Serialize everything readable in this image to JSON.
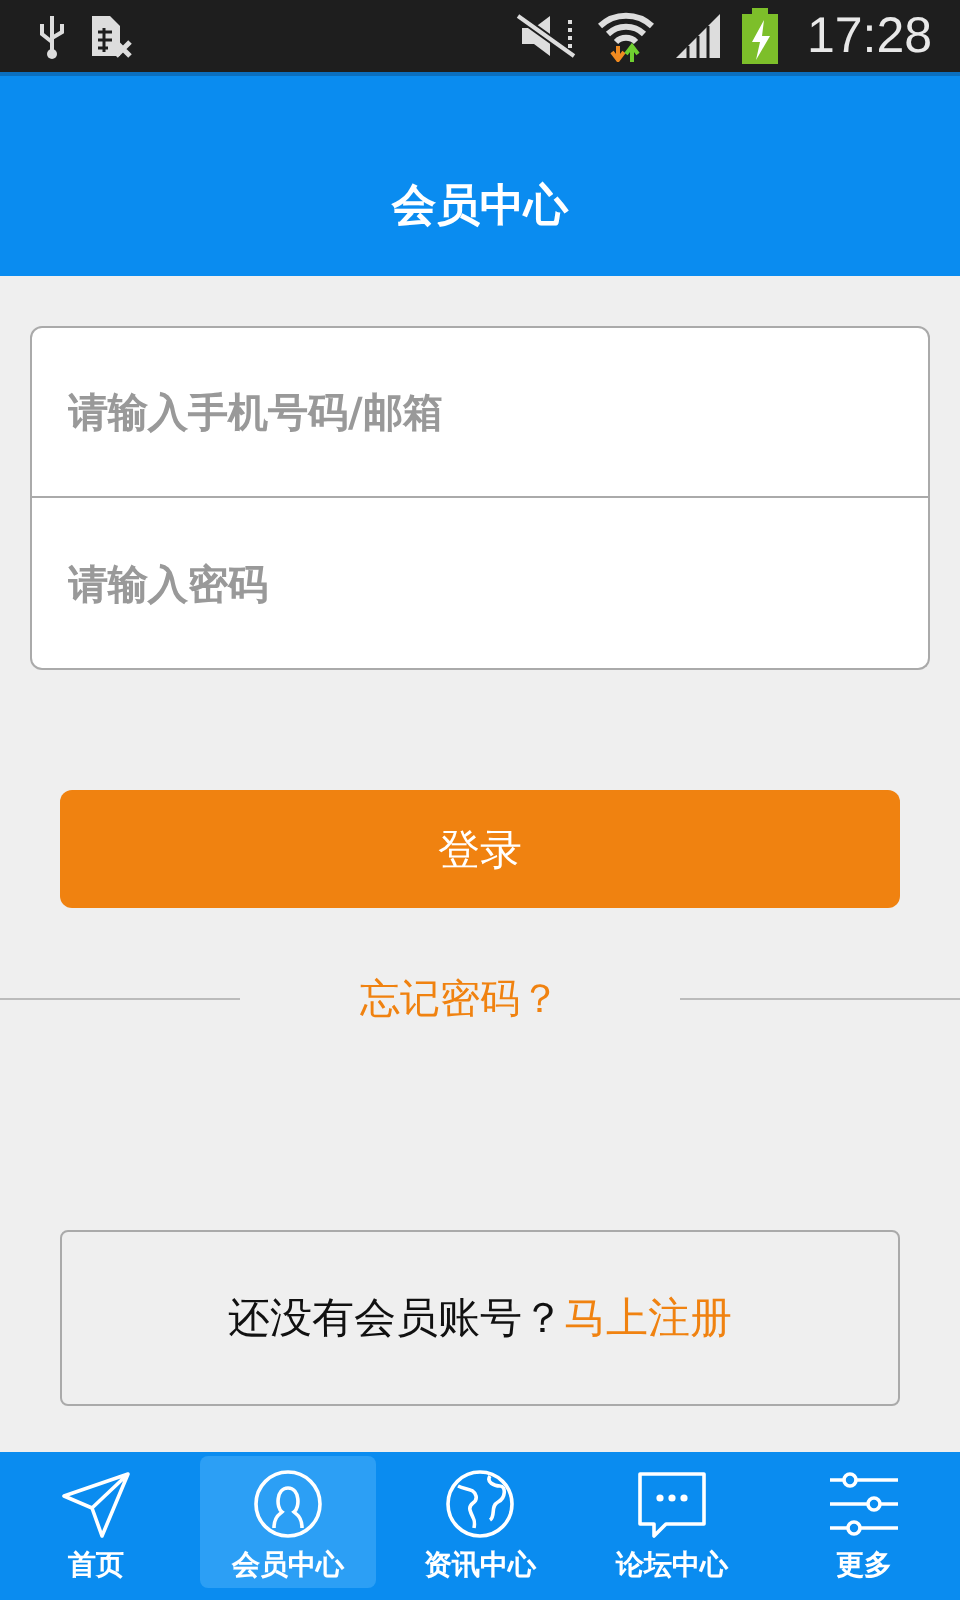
{
  "status_bar": {
    "time": "17:28"
  },
  "header": {
    "title": "会员中心"
  },
  "login_form": {
    "fields": [
      {
        "placeholder": "请输入手机号码/邮箱"
      },
      {
        "placeholder": "请输入密码"
      }
    ],
    "login_button": "登录",
    "forgot_password": "忘记密码？"
  },
  "register": {
    "prompt": "还没有会员账号？",
    "link": "马上注册"
  },
  "tab_bar": [
    {
      "label": "首页",
      "selected": false
    },
    {
      "label": "会员中心",
      "selected": true
    },
    {
      "label": "资讯中心",
      "selected": false
    },
    {
      "label": "论坛中心",
      "selected": false
    },
    {
      "label": "更多",
      "selected": false
    }
  ]
}
